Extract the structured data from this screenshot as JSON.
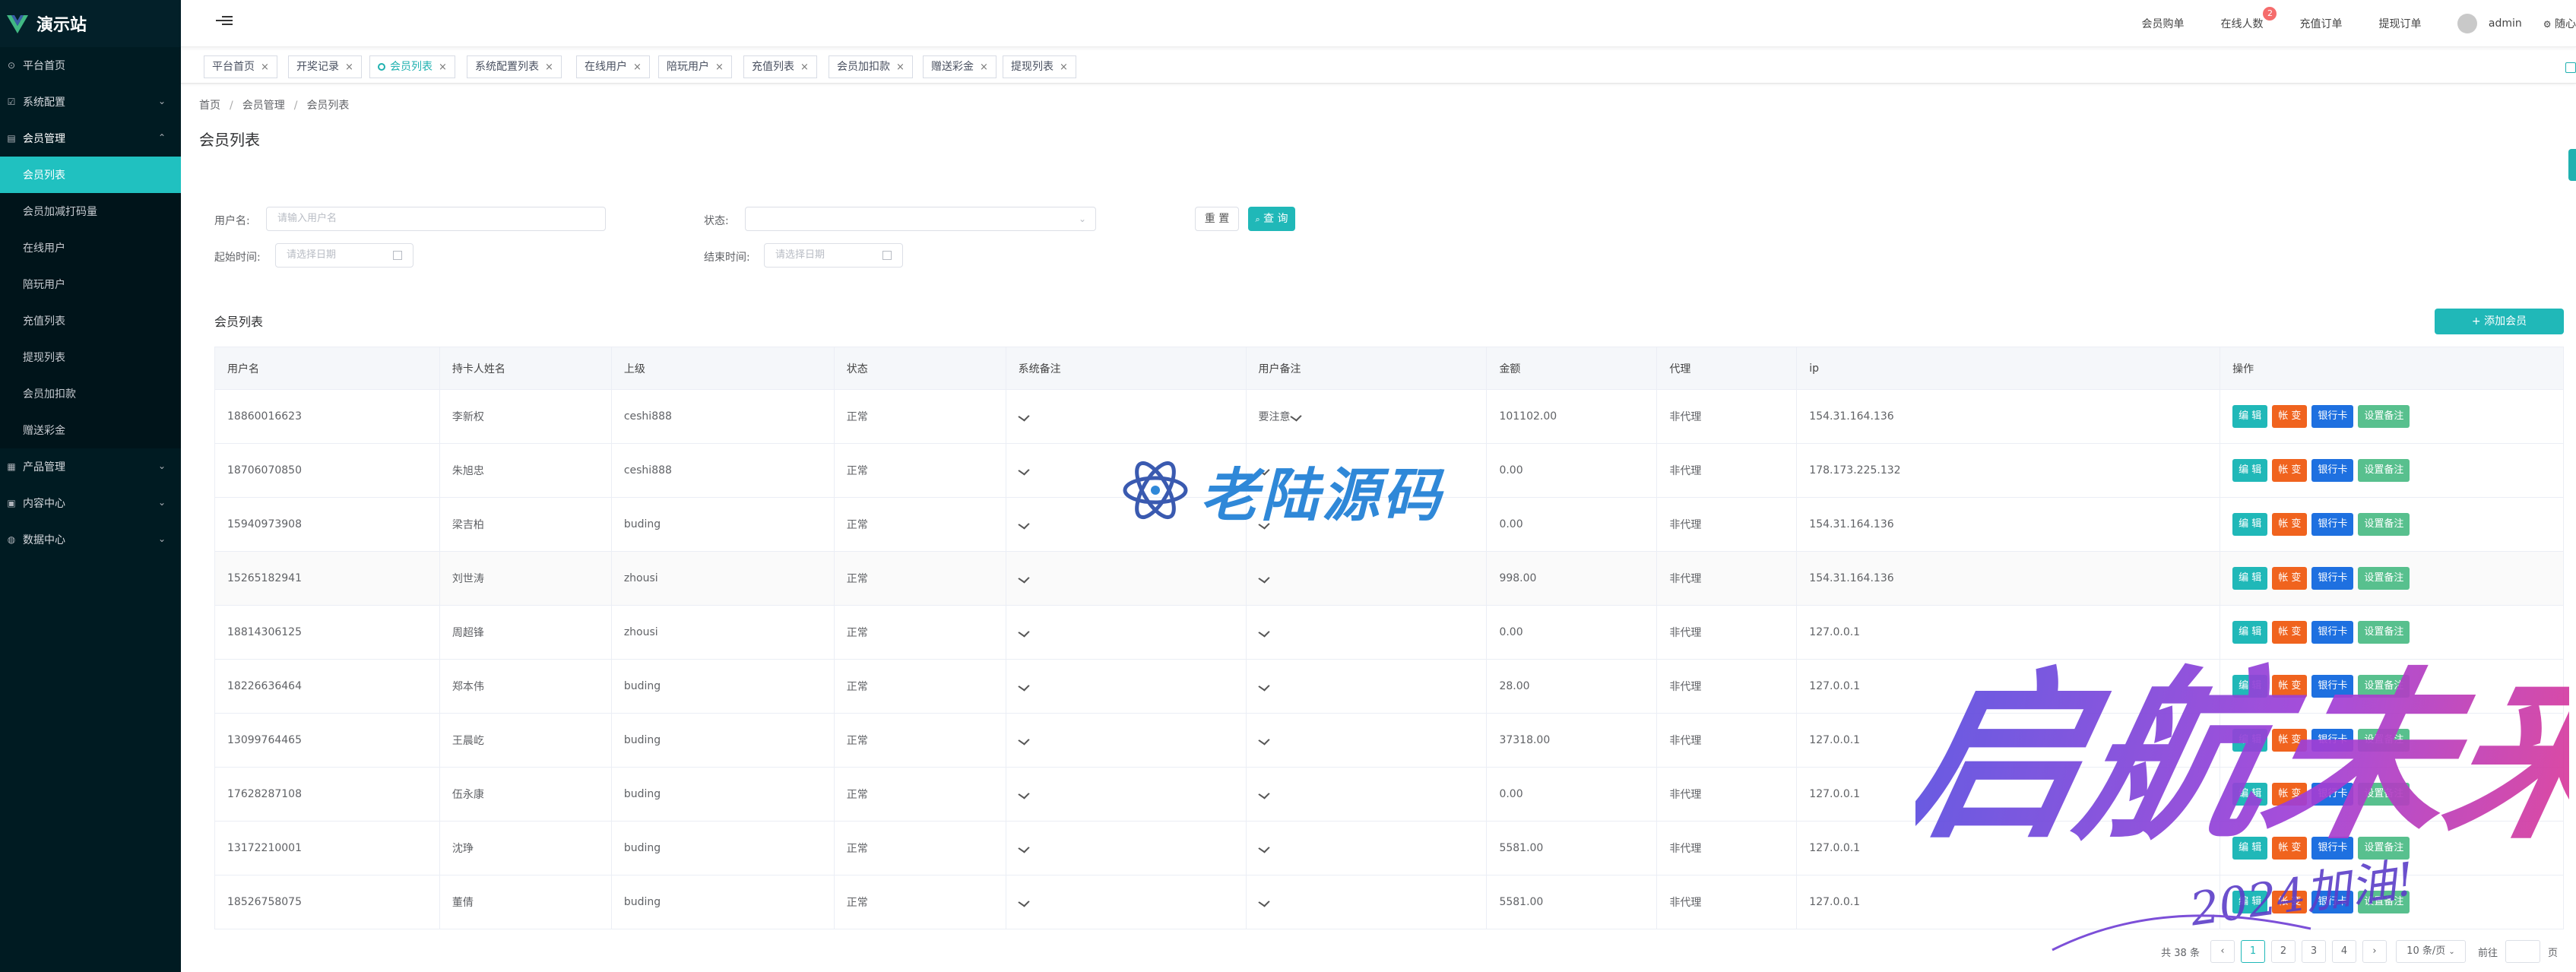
{
  "app": {
    "title": "演示站"
  },
  "sidebar": {
    "items": [
      {
        "label": "平台首页",
        "icon": "home-icon"
      },
      {
        "label": "系统配置",
        "icon": "config-icon",
        "has_children": true
      },
      {
        "label": "会员管理",
        "icon": "member-icon",
        "has_children": true,
        "open": true,
        "children": [
          {
            "label": "会员列表",
            "active": true
          },
          {
            "label": "会员加减打码量"
          },
          {
            "label": "在线用户"
          },
          {
            "label": "陪玩用户"
          },
          {
            "label": "充值列表"
          },
          {
            "label": "提现列表"
          },
          {
            "label": "会员加扣款"
          },
          {
            "label": "赠送彩金"
          }
        ]
      },
      {
        "label": "产品管理",
        "icon": "product-icon",
        "has_children": true
      },
      {
        "label": "内容中心",
        "icon": "content-icon",
        "has_children": true
      },
      {
        "label": "数据中心",
        "icon": "data-icon",
        "has_children": true
      }
    ]
  },
  "header": {
    "links": [
      "会员购单",
      "在线人数",
      "充值订单",
      "提现订单"
    ],
    "online_count": "2",
    "user": "admin",
    "extra": "随心"
  },
  "tags": [
    {
      "label": "平台首页"
    },
    {
      "label": "开奖记录"
    },
    {
      "label": "会员列表",
      "active": true
    },
    {
      "label": "系统配置列表"
    },
    {
      "label": "在线用户"
    },
    {
      "label": "陪玩用户"
    },
    {
      "label": "充值列表"
    },
    {
      "label": "会员加扣款"
    },
    {
      "label": "赠送彩金"
    },
    {
      "label": "提现列表"
    }
  ],
  "breadcrumb": [
    "首页",
    "会员管理",
    "会员列表"
  ],
  "page_title": "会员列表",
  "filters": {
    "username_label": "用户名:",
    "username_placeholder": "请输入用户名",
    "status_label": "状态:",
    "start_label": "起始时间:",
    "start_placeholder": "请选择日期",
    "end_label": "结束时间:",
    "end_placeholder": "请选择日期",
    "reset_label": "重 置",
    "search_label": "查 询"
  },
  "section_title": "会员列表",
  "add_button": "+ 添加会员",
  "table": {
    "columns": [
      "用户名",
      "持卡人姓名",
      "上级",
      "状态",
      "系统备注",
      "用户备注",
      "金额",
      "代理",
      "ip",
      "操作"
    ],
    "rows": [
      {
        "username": "18860016623",
        "cardholder": "李新权",
        "parent": "ceshi888",
        "status": "正常",
        "user_note": "要注意",
        "amount": "101102.00",
        "agent": "非代理",
        "ip": "154.31.164.136"
      },
      {
        "username": "18706070850",
        "cardholder": "朱旭忠",
        "parent": "ceshi888",
        "status": "正常",
        "user_note": "",
        "amount": "0.00",
        "agent": "非代理",
        "ip": "178.173.225.132"
      },
      {
        "username": "15940973908",
        "cardholder": "梁吉柏",
        "parent": "buding",
        "status": "正常",
        "user_note": "",
        "amount": "0.00",
        "agent": "非代理",
        "ip": "154.31.164.136"
      },
      {
        "username": "15265182941",
        "cardholder": "刘世涛",
        "parent": "zhousi",
        "status": "正常",
        "user_note": "",
        "amount": "998.00",
        "agent": "非代理",
        "ip": "154.31.164.136"
      },
      {
        "username": "18814306125",
        "cardholder": "周超锋",
        "parent": "zhousi",
        "status": "正常",
        "user_note": "",
        "amount": "0.00",
        "agent": "非代理",
        "ip": "127.0.0.1"
      },
      {
        "username": "18226636464",
        "cardholder": "郑本伟",
        "parent": "buding",
        "status": "正常",
        "user_note": "",
        "amount": "28.00",
        "agent": "非代理",
        "ip": "127.0.0.1"
      },
      {
        "username": "13099764465",
        "cardholder": "王晨屹",
        "parent": "buding",
        "status": "正常",
        "user_note": "",
        "amount": "37318.00",
        "agent": "非代理",
        "ip": "127.0.0.1"
      },
      {
        "username": "17628287108",
        "cardholder": "伍永康",
        "parent": "buding",
        "status": "正常",
        "user_note": "",
        "amount": "0.00",
        "agent": "非代理",
        "ip": "127.0.0.1"
      },
      {
        "username": "13172210001",
        "cardholder": "沈琤",
        "parent": "buding",
        "status": "正常",
        "user_note": "",
        "amount": "5581.00",
        "agent": "非代理",
        "ip": "127.0.0.1"
      },
      {
        "username": "18526758075",
        "cardholder": "董倩",
        "parent": "buding",
        "status": "正常",
        "user_note": "",
        "amount": "5581.00",
        "agent": "非代理",
        "ip": "127.0.0.1"
      }
    ],
    "actions": [
      "编 辑",
      "帐 变",
      "银行卡",
      "设置备注"
    ]
  },
  "pagination": {
    "total": "共 38 条",
    "pages": [
      "1",
      "2",
      "3",
      "4"
    ],
    "current": "1",
    "page_size": "10 条/页",
    "goto_label": "前往",
    "page_suffix": "页"
  },
  "watermarks": {
    "brand": "老陆源码",
    "calligraphy": "启航未来",
    "slogan": "2024加油!"
  },
  "colors": {
    "sidebar_bg": "#001b22",
    "accent": "#20b8b8",
    "edit": "#20b8b8",
    "account": "#f0631e",
    "bank": "#1e70e0",
    "note": "#58c08e"
  }
}
